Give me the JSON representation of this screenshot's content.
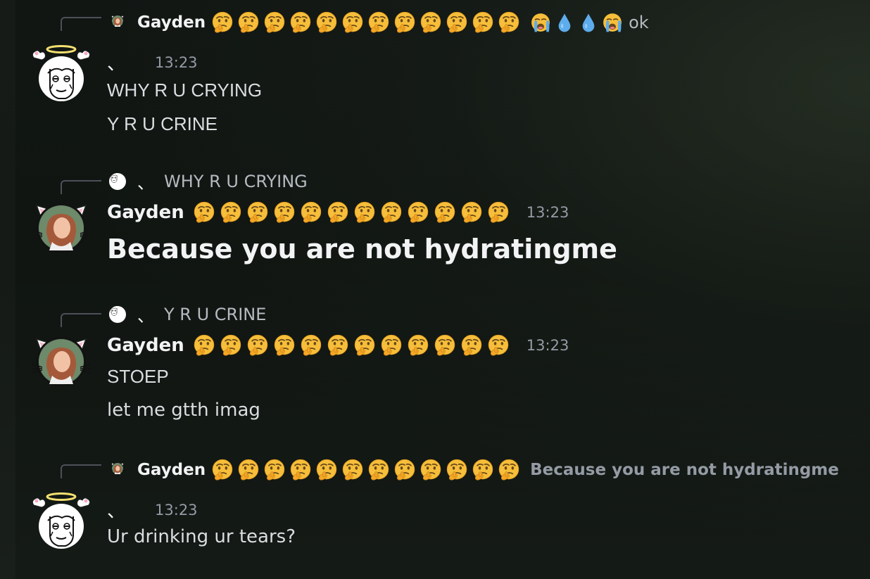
{
  "messages": [
    {
      "reply": {
        "author": "Gayden",
        "preview": "ok",
        "emoji": [
          "thinking-face",
          "thinking-face",
          "thinking-face",
          "thinking-face",
          "thinking-face",
          "thinking-face",
          "thinking-face",
          "thinking-face",
          "thinking-face",
          "thinking-face",
          "thinking-face",
          "thinking-face",
          "loudly-crying-face",
          "droplet",
          "droplet",
          "loudly-crying-face"
        ]
      },
      "author": "、",
      "timestamp": "13:23",
      "lines": [
        "WHY R U CRYING",
        "Y R U CRINE"
      ]
    },
    {
      "reply": {
        "author": "、",
        "preview": "WHY R U CRYING"
      },
      "author": "Gayden",
      "timestamp": "13:23",
      "lines": [
        "Because you are not hydratingme"
      ]
    },
    {
      "reply": {
        "author": "、",
        "preview": "Y R U CRINE"
      },
      "author": "Gayden",
      "timestamp": "13:23",
      "lines": [
        "STOEP",
        "let me gtth imag"
      ]
    },
    {
      "reply": {
        "author": "Gayden",
        "preview": "Because you are not hydratingme"
      },
      "author": "、",
      "timestamp": "13:23",
      "lines": [
        "Ur drinking ur tears?"
      ]
    }
  ],
  "colors": {
    "background": "#111613",
    "text": "#dbdee1",
    "muted": "#949ba4",
    "username": "#f2f3f5",
    "emoji_yellow": "#f9c33c"
  },
  "icons": {
    "thinking": "thinking-face-emoji",
    "crying": "loudly-crying-face-emoji",
    "droplet": "droplet-emoji",
    "avatar_angel": "angel-halo-sketch-avatar",
    "avatar_cat": "cat-ear-photo-avatar"
  }
}
